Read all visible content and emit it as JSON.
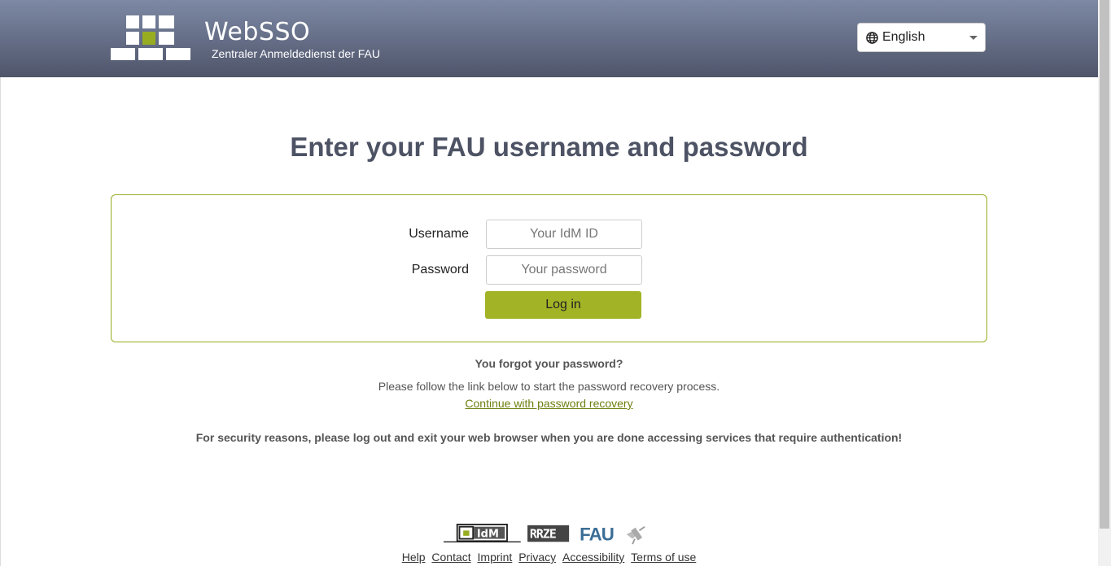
{
  "header": {
    "brand_title": "WebSSO",
    "brand_subtitle": "Zentraler Anmeldedienst der FAU",
    "language": {
      "selected": "English",
      "icon": "globe-icon"
    }
  },
  "main": {
    "title": "Enter your FAU username and password",
    "form": {
      "username_label": "Username",
      "username_placeholder": "Your IdM ID",
      "password_label": "Password",
      "password_placeholder": "Your password",
      "login_label": "Log in"
    },
    "forgot_heading": "You forgot your password?",
    "forgot_text": "Please follow the link below to start the password recovery process.",
    "recovery_link": "Continue with password recovery",
    "security_notice": "For security reasons, please log out and exit your web browser when you are done accessing services that require authentication!"
  },
  "footer": {
    "logos": [
      "IdM",
      "RRZE",
      "FAU"
    ],
    "links": [
      "Help",
      "Contact",
      "Imprint",
      "Privacy",
      "Accessibility",
      "Terms of use"
    ]
  },
  "colors": {
    "accent": "#a2b426",
    "header_top": "#7d89a5",
    "header_bottom": "#4f556a",
    "title": "#4d5364"
  }
}
